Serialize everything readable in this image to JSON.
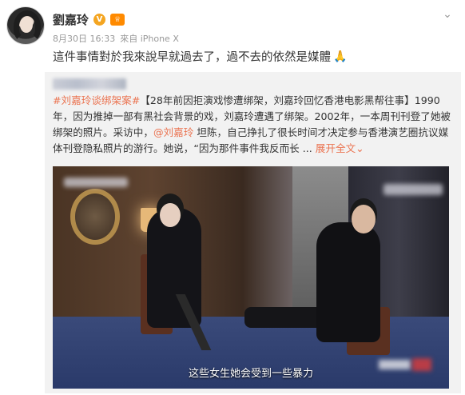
{
  "post": {
    "username": "劉嘉玲",
    "verified_badge": "V",
    "level_badge": "♕",
    "date": "8月30日 16:33",
    "source": "來自 iPhone X",
    "text": "這件事情對於我來說早就過去了，過不去的依然是媒體",
    "pray_icon": "🙏",
    "menu_icon": "chevron-down-icon"
  },
  "repost": {
    "hashtag": "#刘嘉玲谈绑架案#",
    "body_part1": "【28年前因拒演戏惨遭绑架，刘嘉玲回忆香港电影黑帮往事】1990年，因为推掉一部有黑社会背景的戏，刘嘉玲遭遇了绑架。2002年，一本周刊刊登了她被绑架的照片。采访中，",
    "mention": "@刘嘉玲",
    "body_part2": " 坦陈，自己挣扎了很长时间才决定参与香港演艺圈抗议媒体刊登隐私照片的游行。她说，“因为那件事件我反而长 ... ",
    "expand_label": "展开全文",
    "expand_icon": "⌄",
    "video": {
      "subtitle": "这些女生她会受到一些暴力"
    }
  },
  "colors": {
    "accent": "#eb7350",
    "card_bg": "#f2f2f2",
    "meta_text": "#999999"
  }
}
